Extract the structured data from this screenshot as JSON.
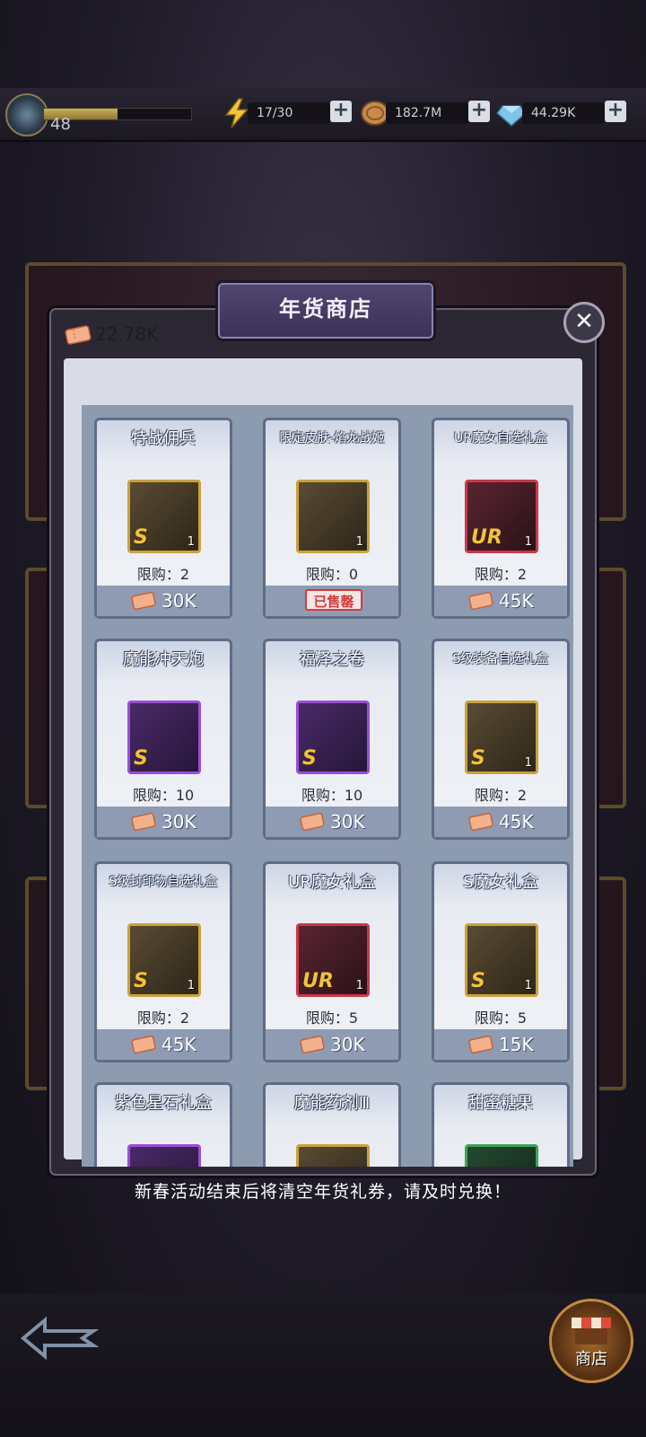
{
  "status_bar": {
    "level": "48",
    "xp_progress": 0.5,
    "energy": "17/30",
    "gold": "182.7M",
    "gems": "44.29K"
  },
  "shop": {
    "title": "年货商店",
    "currency_amount": "22.78K",
    "items": [
      {
        "name": "特战佣兵",
        "limit": "限购：2",
        "price": "30K",
        "frame": "gold",
        "rank": "S",
        "count": "1",
        "sold_out": false
      },
      {
        "name": "限定皮肤-焰龙战姬",
        "limit": "限购：0",
        "price": "",
        "frame": "gold",
        "rank": "",
        "count": "1",
        "sold_out": true
      },
      {
        "name": "UR魔女自选礼盒",
        "limit": "限购：2",
        "price": "45K",
        "frame": "red",
        "rank": "UR",
        "count": "1",
        "sold_out": false
      },
      {
        "name": "魔能冲天炮",
        "limit": "限购：10",
        "price": "30K",
        "frame": "purple",
        "rank": "S",
        "count": "",
        "sold_out": false
      },
      {
        "name": "福泽之卷",
        "limit": "限购：10",
        "price": "30K",
        "frame": "purple",
        "rank": "S",
        "count": "",
        "sold_out": false
      },
      {
        "name": "S级装备自选礼盒",
        "limit": "限购：2",
        "price": "45K",
        "frame": "gold",
        "rank": "S",
        "count": "1",
        "sold_out": false
      },
      {
        "name": "S级封印物自选礼盒",
        "limit": "限购：2",
        "price": "45K",
        "frame": "gold",
        "rank": "S",
        "count": "1",
        "sold_out": false
      },
      {
        "name": "UR魔女礼盒",
        "limit": "限购：5",
        "price": "30K",
        "frame": "red",
        "rank": "UR",
        "count": "1",
        "sold_out": false
      },
      {
        "name": "S魔女礼盒",
        "limit": "限购：5",
        "price": "15K",
        "frame": "gold",
        "rank": "S",
        "count": "1",
        "sold_out": false
      },
      {
        "name": "紫色星石礼盒",
        "limit": "",
        "price": "",
        "frame": "purple",
        "rank": "",
        "count": "",
        "sold_out": false
      },
      {
        "name": "魔能药剂Ⅲ",
        "limit": "",
        "price": "",
        "frame": "gold",
        "rank": "",
        "count": "",
        "sold_out": false
      },
      {
        "name": "甜蜜糖果",
        "limit": "",
        "price": "",
        "frame": "green",
        "rank": "",
        "count": "",
        "sold_out": false
      }
    ],
    "sold_out_label": "已售罄"
  },
  "footer_note": "新春活动结束后将清空年货礼券，请及时兑换！",
  "bottom_nav": {
    "shop_label": "商店"
  },
  "icons": {
    "energy": "lightning-icon",
    "gold": "coin-icon",
    "gems": "diamond-icon",
    "ticket": "ticket-icon"
  }
}
